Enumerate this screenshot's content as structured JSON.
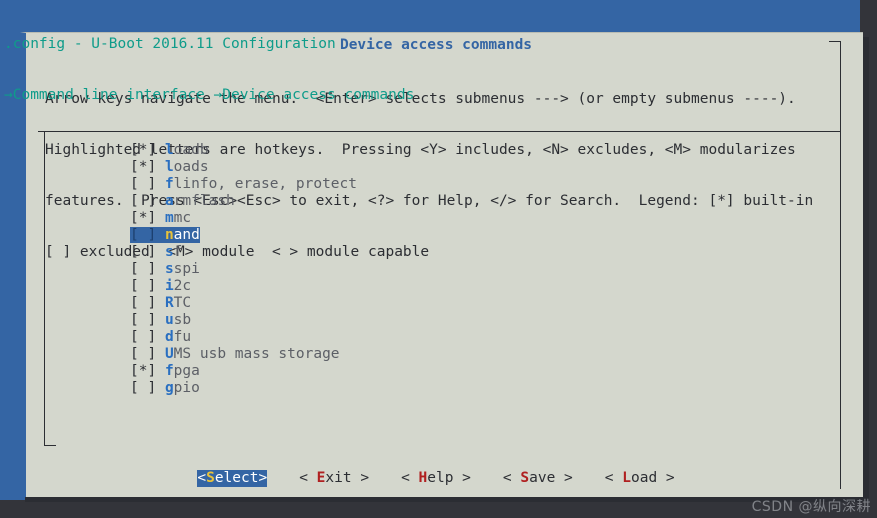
{
  "terminal": {
    "background_color": "#3465a4",
    "outside_color": "#33343a",
    "breadcrumb_color": "#0e9c8a"
  },
  "breadcrumb": {
    "line1": ".config - U-Boot 2016.11 Configuration",
    "line2": "→Command line interface →Device access commands"
  },
  "dialog": {
    "title": "Device access commands",
    "background_color": "#d4d7cd",
    "title_color": "#3465a4",
    "help_lines": [
      "Arrow keys navigate the menu.  <Enter> selects submenus ---> (or empty submenus ----).",
      "Highlighted letters are hotkeys.  Pressing <Y> includes, <N> excludes, <M> modularizes",
      "features.  Press <Esc><Esc> to exit, <?> for Help, </> for Search.  Legend: [*] built-in",
      "[ ] excluded  <M> module  < > module capable"
    ]
  },
  "menu": {
    "selected_index": 5,
    "selected_color": "#3465a4",
    "hotkey_color": "#2a6fc0",
    "selected_hotkey_color": "#e8c23a",
    "items": [
      {
        "marker": "[*]",
        "hotkey": "l",
        "rest": "oadb"
      },
      {
        "marker": "[*]",
        "hotkey": "l",
        "rest": "oads"
      },
      {
        "marker": "[ ]",
        "hotkey": "f",
        "rest": "linfo, erase, protect"
      },
      {
        "marker": "[ ]",
        "hotkey": "a",
        "rest": "rmflash"
      },
      {
        "marker": "[*]",
        "hotkey": "m",
        "rest": "mc"
      },
      {
        "marker": "[ ]",
        "hotkey": "n",
        "rest": "and"
      },
      {
        "marker": "[ ]",
        "hotkey": "s",
        "rest": "f"
      },
      {
        "marker": "[ ]",
        "hotkey": "s",
        "rest": "spi"
      },
      {
        "marker": "[ ]",
        "hotkey": "i",
        "rest": "2c"
      },
      {
        "marker": "[ ]",
        "hotkey": "R",
        "rest": "TC"
      },
      {
        "marker": "[ ]",
        "hotkey": "u",
        "rest": "sb"
      },
      {
        "marker": "[ ]",
        "hotkey": "d",
        "rest": "fu"
      },
      {
        "marker": "[ ]",
        "hotkey": "U",
        "rest": "MS usb mass storage"
      },
      {
        "marker": "[*]",
        "hotkey": "f",
        "rest": "pga"
      },
      {
        "marker": "[ ]",
        "hotkey": "g",
        "rest": "pio"
      }
    ]
  },
  "buttons": {
    "active_index": 0,
    "hotkey_color": "#b02020",
    "items": [
      {
        "pre": "<",
        "hot": "S",
        "post": "elect>",
        "name": "select"
      },
      {
        "pre": "< ",
        "hot": "E",
        "post": "xit >",
        "name": "exit"
      },
      {
        "pre": "< ",
        "hot": "H",
        "post": "elp >",
        "name": "help"
      },
      {
        "pre": "< ",
        "hot": "S",
        "post": "ave >",
        "name": "save"
      },
      {
        "pre": "< ",
        "hot": "L",
        "post": "oad >",
        "name": "load"
      }
    ]
  },
  "watermark": {
    "text": "CSDN @纵向深耕"
  }
}
